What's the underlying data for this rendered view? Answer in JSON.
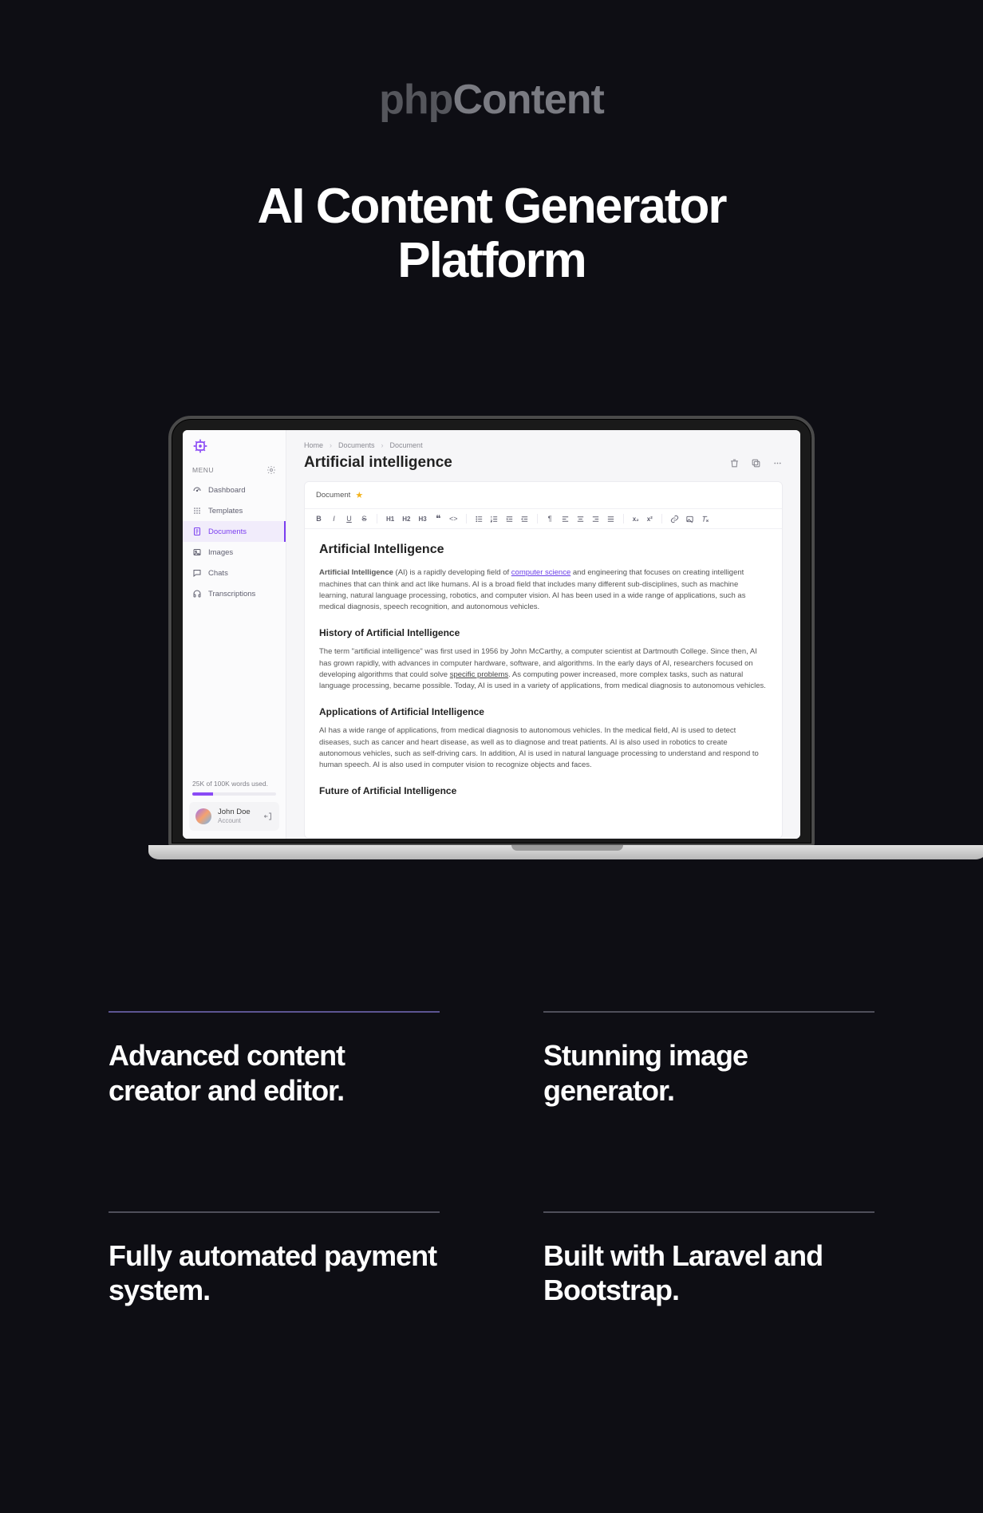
{
  "brand": {
    "prefix": "php",
    "suffix": "Content"
  },
  "headline_l1": "AI Content Generator",
  "headline_l2": "Platform",
  "app": {
    "menu_label": "MENU",
    "nav": [
      {
        "label": "Dashboard"
      },
      {
        "label": "Templates"
      },
      {
        "label": "Documents"
      },
      {
        "label": "Images"
      },
      {
        "label": "Chats"
      },
      {
        "label": "Transcriptions"
      }
    ],
    "usage_text": "25K of 100K words used.",
    "user": {
      "name": "John Doe",
      "subtitle": "Account"
    },
    "breadcrumbs": [
      "Home",
      "Documents",
      "Document"
    ],
    "doc_title": "Artificial intelligence",
    "paper_label": "Document",
    "content": {
      "h1": "Artificial Intelligence",
      "intro_b": "Artificial Intelligence",
      "intro_1": " (AI) is a rapidly developing field of ",
      "intro_link": "computer science",
      "intro_2": " and engineering that focuses on creating intelligent machines that can think and act like humans. AI is a broad field that includes many different sub-disciplines, such as machine learning, natural language processing, robotics, and computer vision. AI has been used in a wide range of applications, such as medical diagnosis, speech recognition, and autonomous vehicles.",
      "h2_1": "History of Artificial Intelligence",
      "p1_a": "The term \"artificial intelligence\" was first used in 1956 by John McCarthy, a computer scientist at Dartmouth College. Since then, AI has grown rapidly, with advances in computer hardware, software, and algorithms. In the early days of AI, researchers focused on developing algorithms that could solve ",
      "p1_u": "specific problems",
      "p1_b": ". As computing power increased, more complex tasks, such as natural language processing, became possible. Today, AI is used in a variety of applications, from medical diagnosis to autonomous vehicles.",
      "h2_2": "Applications of Artificial Intelligence",
      "p2": "AI has a wide range of applications, from medical diagnosis to autonomous vehicles. In the medical field, AI is used to detect diseases, such as cancer and heart disease, as well as to diagnose and treat patients. AI is also used in robotics to create autonomous vehicles, such as self-driving cars. In addition, AI is used in natural language processing to understand and respond to human speech. AI is also used in computer vision to recognize objects and faces.",
      "h2_3": "Future of Artificial Intelligence"
    },
    "toolbar": {
      "h1": "H1",
      "h2": "H2",
      "h3": "H3",
      "sub": "x₂",
      "sup": "x²"
    }
  },
  "features": [
    "Advanced content creator and editor.",
    "Stunning image generator.",
    "Fully automated payment system.",
    "Built with Laravel and Bootstrap."
  ]
}
